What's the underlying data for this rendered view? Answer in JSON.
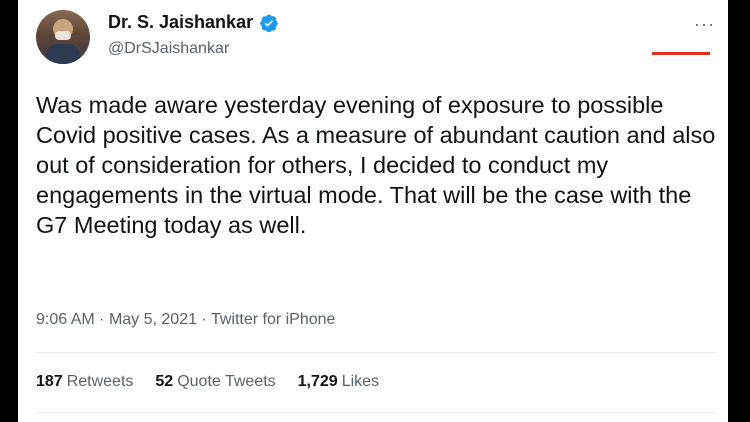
{
  "author": {
    "display_name": "Dr. S. Jaishankar",
    "handle": "@DrSJaishankar",
    "verified": true,
    "avatar_icon": "profile-photo"
  },
  "menu": {
    "more_label": "···"
  },
  "tweet": {
    "text": "Was made aware yesterday evening of exposure to possible Covid positive cases. As a measure of abundant caution and also out of consideration for others, I decided to conduct my engagements in the virtual mode. That will be the case with the G7 Meeting today as well.",
    "time": "9:06 AM",
    "separator": "·",
    "date": "May 5, 2021",
    "source": "Twitter for iPhone"
  },
  "stats": {
    "retweets_count": "187",
    "retweets_label": "Retweets",
    "quotes_count": "52",
    "quotes_label": "Quote Tweets",
    "likes_count": "1,729",
    "likes_label": "Likes"
  },
  "colors": {
    "verified_badge": "#1d9bf0",
    "accent_line": "#e0301e",
    "text_primary": "#0f1419",
    "text_secondary": "#536471"
  }
}
